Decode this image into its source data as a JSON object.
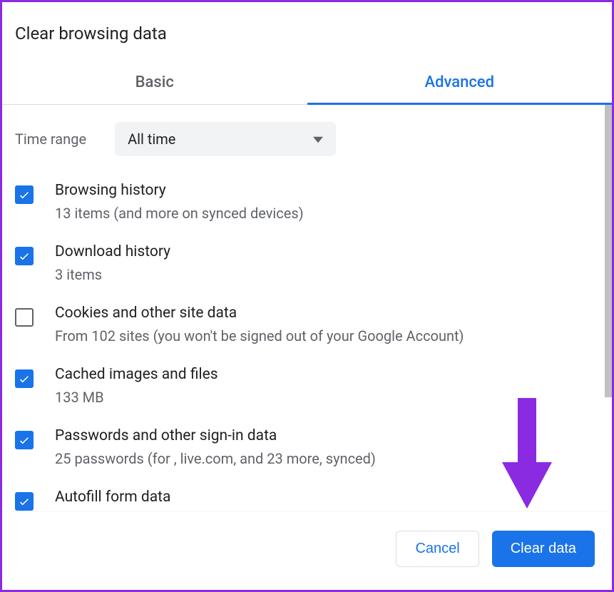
{
  "dialog": {
    "title": "Clear browsing data",
    "tabs": {
      "basic": "Basic",
      "advanced": "Advanced"
    },
    "time_range": {
      "label": "Time range",
      "value": "All time"
    },
    "items": [
      {
        "title": "Browsing history",
        "sub": "13 items (and more on synced devices)",
        "checked": true
      },
      {
        "title": "Download history",
        "sub": "3 items",
        "checked": true
      },
      {
        "title": "Cookies and other site data",
        "sub": "From 102 sites (you won't be signed out of your Google Account)",
        "checked": false
      },
      {
        "title": "Cached images and files",
        "sub": "133 MB",
        "checked": true
      },
      {
        "title": "Passwords and other sign-in data",
        "sub": "25 passwords (for , live.com, and 23 more, synced)",
        "checked": true
      },
      {
        "title": "Autofill form data",
        "sub": "",
        "checked": true
      }
    ],
    "buttons": {
      "cancel": "Cancel",
      "clear": "Clear data"
    }
  }
}
